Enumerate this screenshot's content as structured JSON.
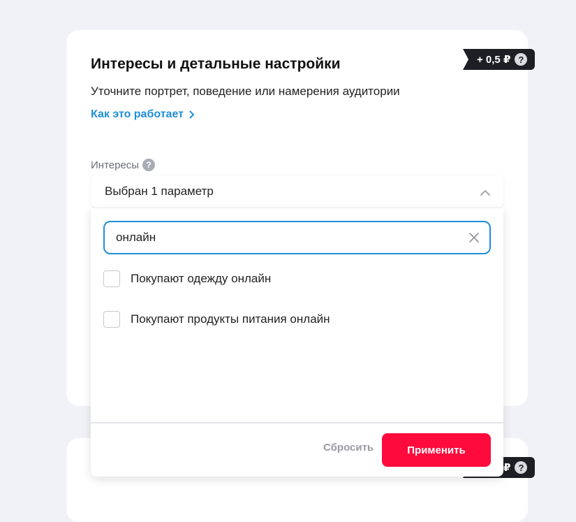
{
  "section": {
    "title": "Интересы и детальные настройки",
    "subtitle": "Уточните портрет, поведение или намерения аудитории",
    "how_link": "Как это работает",
    "price_badge": "+ 0,5 ₽",
    "bottom_badge": "₽"
  },
  "interests": {
    "label": "Интересы",
    "selected_summary": "Выбран 1 параметр",
    "search_value": "онлайн",
    "options": [
      {
        "label": "Покупают одежду онлайн",
        "checked": false
      },
      {
        "label": "Покупают продукты питания онлайн",
        "checked": false
      }
    ],
    "reset_label": "Сбросить",
    "apply_label": "Применить"
  },
  "colors": {
    "accent_blue": "#1f8fd6",
    "apply_red": "#ff0a3c",
    "badge_dark": "#1d1f25"
  }
}
